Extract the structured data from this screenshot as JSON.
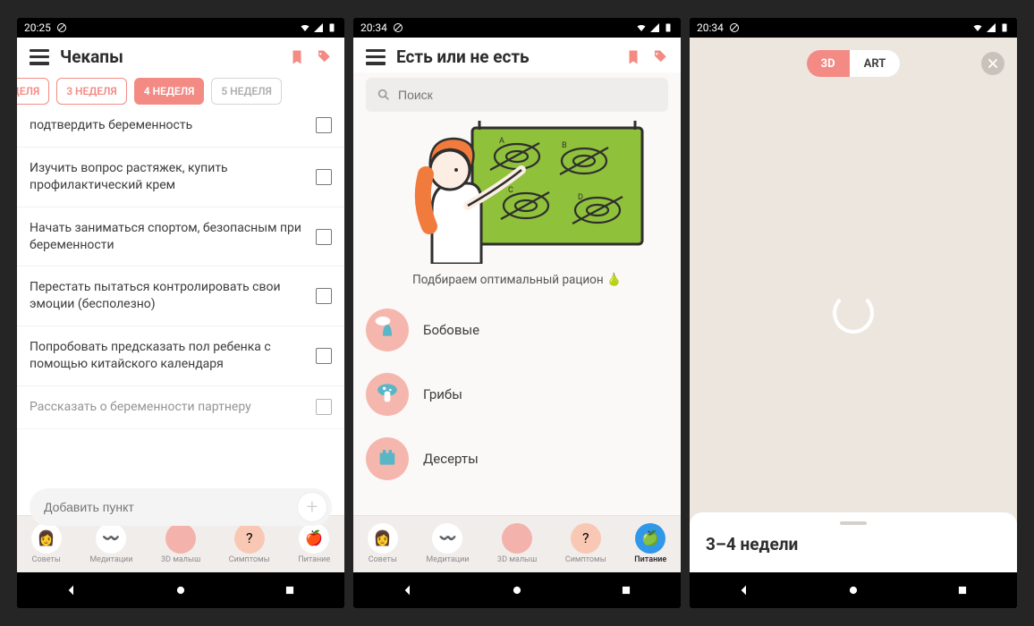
{
  "status": {
    "time1": "20:25",
    "time2": "20:34"
  },
  "s1": {
    "title": "Чекапы",
    "weeks": [
      {
        "label": "ЕДЕЛЯ"
      },
      {
        "label": "3 НЕДЕЛЯ"
      },
      {
        "label": "4 НЕДЕЛЯ"
      },
      {
        "label": "5 НЕДЕЛЯ"
      }
    ],
    "items": [
      "подтвердить беременность",
      "Изучить вопрос растяжек, купить профилактический крем",
      "Начать заниматься спортом, безопасным при беременности",
      "Перестать пытаться контролировать свои эмоции (бесполезно)",
      "Попробовать предсказать пол ребенка с помощью китайского календаря",
      "Рассказать о беременности партнеру"
    ],
    "addPlaceholder": "Добавить пункт"
  },
  "s2": {
    "title": "Есть или не есть",
    "searchPlaceholder": "Поиск",
    "caption": "Подбираем оптимальный рацион 🍐",
    "foods": [
      "Бобовые",
      "Грибы",
      "Десерты"
    ]
  },
  "s3": {
    "toggle3d": "3D",
    "toggleArt": "ART",
    "sheetTitle": "3–4 недели"
  },
  "tabs": {
    "t0": "Советы",
    "t1": "Медитации",
    "t2": "3D малыш",
    "t3": "Симптомы",
    "t4": "Питание"
  }
}
